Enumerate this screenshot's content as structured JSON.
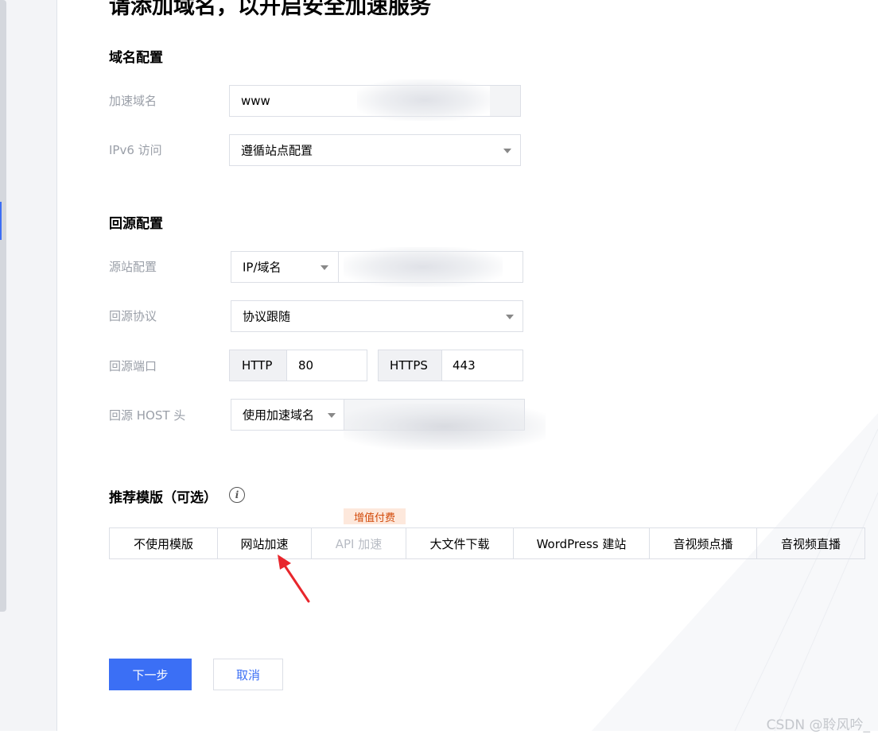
{
  "page": {
    "title": "请添加域名，以开启安全加速服务"
  },
  "domain_config": {
    "section_title": "域名配置",
    "accel_domain": {
      "label": "加速域名",
      "value": "www"
    },
    "ipv6": {
      "label": "IPv6 访问",
      "value": "遵循站点配置"
    }
  },
  "origin_config": {
    "section_title": "回源配置",
    "origin_site": {
      "label": "源站配置",
      "type_value": "IP/域名"
    },
    "protocol": {
      "label": "回源协议",
      "value": "协议跟随"
    },
    "port": {
      "label": "回源端口",
      "http_label": "HTTP",
      "http_value": "80",
      "https_label": "HTTPS",
      "https_value": "443"
    },
    "host": {
      "label": "回源 HOST 头",
      "type_value": "使用加速域名"
    }
  },
  "templates": {
    "section_title": "推荐模版（可选）",
    "badge": "增值付费",
    "items": [
      {
        "label": "不使用模版",
        "disabled": false
      },
      {
        "label": "网站加速",
        "disabled": false
      },
      {
        "label": "API 加速",
        "disabled": true
      },
      {
        "label": "大文件下载",
        "disabled": false
      },
      {
        "label": "WordPress 建站",
        "disabled": false
      },
      {
        "label": "音视频点播",
        "disabled": false
      },
      {
        "label": "音视频直播",
        "disabled": false
      }
    ]
  },
  "actions": {
    "next": "下一步",
    "cancel": "取消"
  },
  "watermark": "CSDN @聆风吟_",
  "colors": {
    "primary": "#3b6ff5",
    "badge_bg": "#fde8dc",
    "badge_text": "#d24a0a",
    "arrow": "#e8262c"
  }
}
